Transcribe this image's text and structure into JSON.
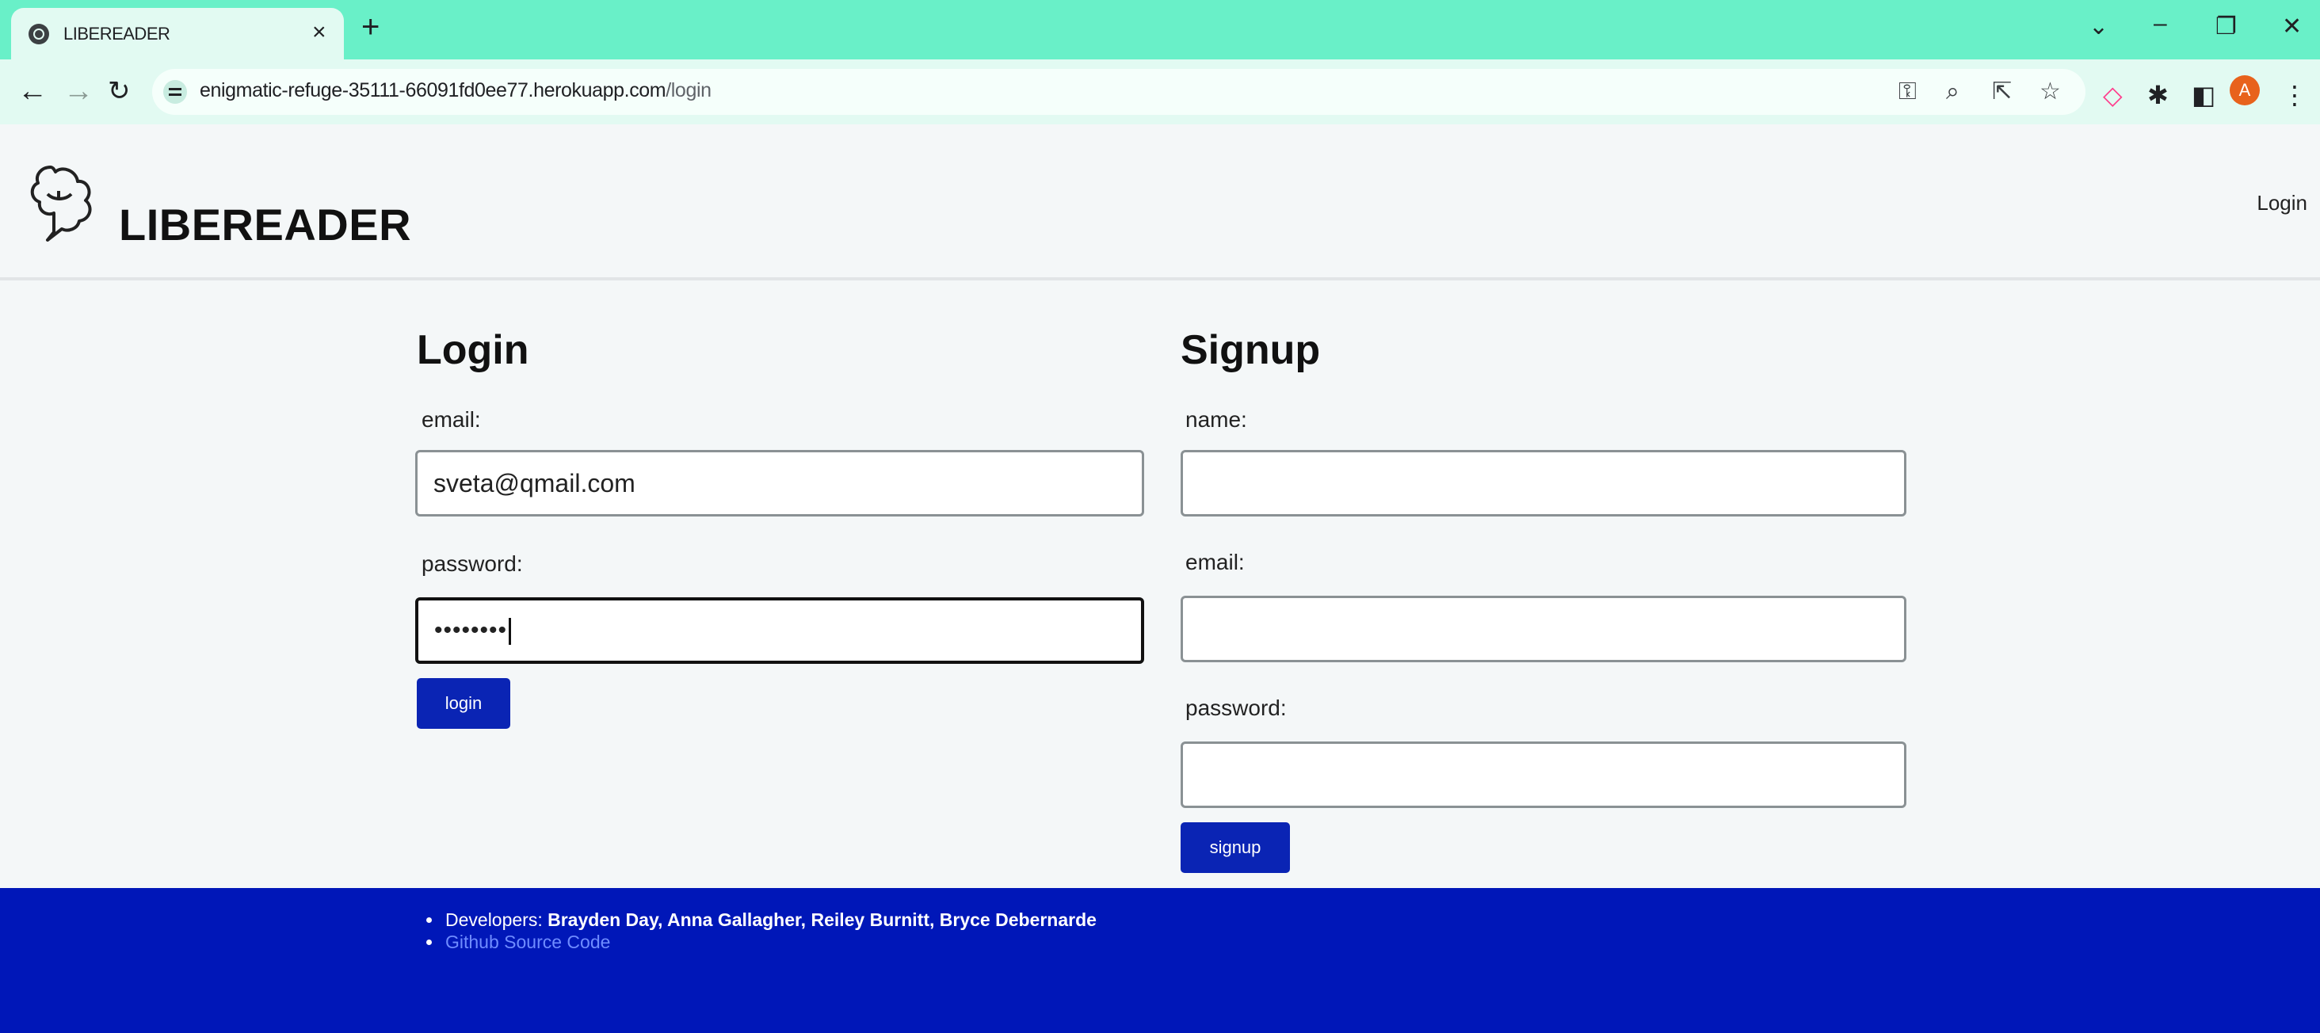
{
  "browser": {
    "tab_title": "LIBEREADER",
    "tab_close": "×",
    "new_tab": "+",
    "url_host": "enigmatic-refuge-35111-66091fd0ee77.herokuapp.com",
    "url_path": "/login",
    "profile_initial": "A",
    "icons": [
      "globe-icon",
      "close-icon",
      "plus-icon",
      "chevron-down-icon",
      "minimize-icon",
      "restore-icon",
      "window-close-icon",
      "back-icon",
      "forward-icon",
      "reload-icon",
      "site-settings-icon",
      "key-icon",
      "zoom-icon",
      "share-icon",
      "star-icon",
      "extension-icon",
      "puzzle-icon",
      "sidepanel-icon",
      "menu-icon"
    ]
  },
  "header": {
    "brand": "LIBEREADER",
    "nav_login": "Login"
  },
  "login": {
    "heading": "Login",
    "email_label": "email:",
    "email_value": "sveta@qmail.com",
    "password_label": "password:",
    "password_value": "••••••••",
    "button": "login"
  },
  "signup": {
    "heading": "Signup",
    "name_label": "name:",
    "name_value": "",
    "email_label": "email:",
    "email_value": "",
    "password_label": "password:",
    "password_value": "",
    "button": "signup"
  },
  "footer": {
    "developers_label": "Developers: ",
    "developers_names": "Brayden Day, Anna Gallagher, Reiley Burnitt, Bryce Debernarde",
    "source_link": "Github Source Code"
  },
  "colors": {
    "chrome_tabstrip": "#69f0c8",
    "chrome_toolbar": "#e2faf2",
    "button_blue": "#0a24b4",
    "footer_blue": "#0017b8",
    "link_blue": "#6f8cff"
  }
}
